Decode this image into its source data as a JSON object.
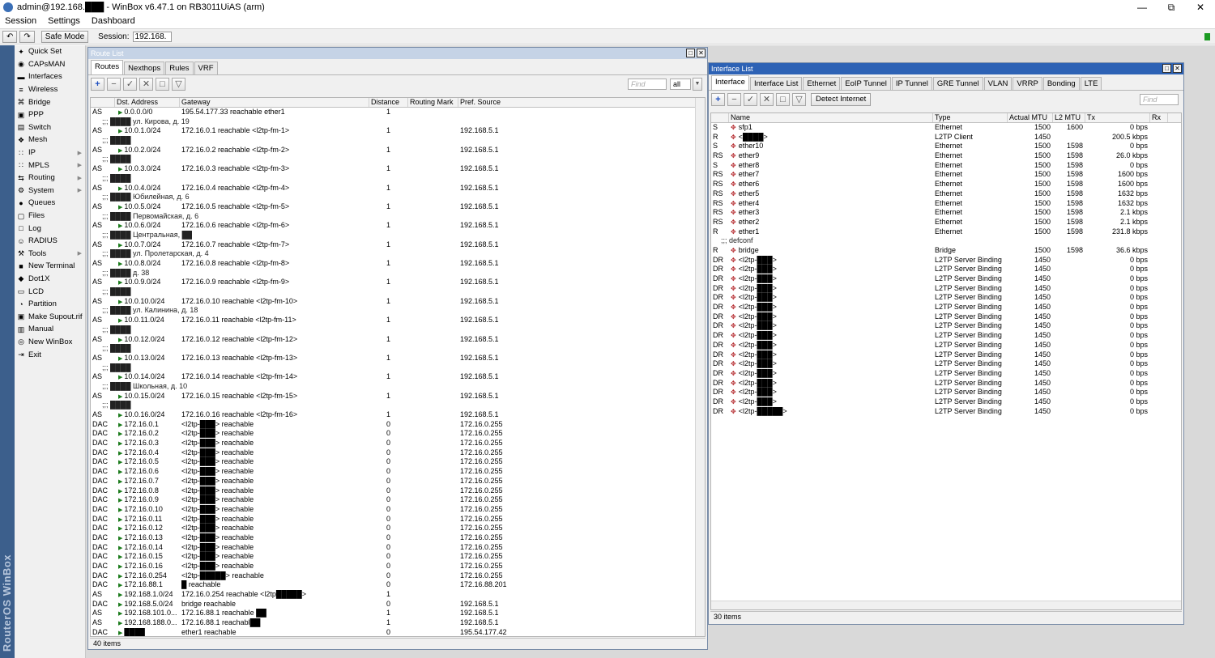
{
  "window": {
    "title": "admin@192.168.███ - WinBox v6.47.1 on RB3011UiAS (arm)",
    "controls": [
      "—",
      "⧉",
      "✕"
    ]
  },
  "menu": [
    "Session",
    "Settings",
    "Dashboard"
  ],
  "toolbar": {
    "undo": "↶",
    "redo": "↷",
    "safe_mode": "Safe Mode",
    "session_label": "Session:",
    "session_value": "192.168."
  },
  "brand_text": "RouterOS WinBox",
  "sidebar": [
    {
      "label": "Quick Set",
      "icon": "wand-icon",
      "glyph": "✦",
      "sub": false
    },
    {
      "label": "CAPsMAN",
      "icon": "capsman-icon",
      "glyph": "◉",
      "sub": false
    },
    {
      "label": "Interfaces",
      "icon": "interfaces-icon",
      "glyph": "▬",
      "sub": false
    },
    {
      "label": "Wireless",
      "icon": "wireless-icon",
      "glyph": "≡",
      "sub": false
    },
    {
      "label": "Bridge",
      "icon": "bridge-icon",
      "glyph": "⌘",
      "sub": false
    },
    {
      "label": "PPP",
      "icon": "ppp-icon",
      "glyph": "▣",
      "sub": false
    },
    {
      "label": "Switch",
      "icon": "switch-icon",
      "glyph": "▤",
      "sub": false
    },
    {
      "label": "Mesh",
      "icon": "mesh-icon",
      "glyph": "❖",
      "sub": false
    },
    {
      "label": "IP",
      "icon": "ip-icon",
      "glyph": "∷",
      "sub": true
    },
    {
      "label": "MPLS",
      "icon": "mpls-icon",
      "glyph": "∷",
      "sub": true
    },
    {
      "label": "Routing",
      "icon": "routing-icon",
      "glyph": "⇆",
      "sub": true
    },
    {
      "label": "System",
      "icon": "system-icon",
      "glyph": "⚙",
      "sub": true
    },
    {
      "label": "Queues",
      "icon": "queues-icon",
      "glyph": "●",
      "sub": false
    },
    {
      "label": "Files",
      "icon": "files-icon",
      "glyph": "▢",
      "sub": false
    },
    {
      "label": "Log",
      "icon": "log-icon",
      "glyph": "□",
      "sub": false
    },
    {
      "label": "RADIUS",
      "icon": "radius-icon",
      "glyph": "☺",
      "sub": false
    },
    {
      "label": "Tools",
      "icon": "tools-icon",
      "glyph": "⚒",
      "sub": true
    },
    {
      "label": "New Terminal",
      "icon": "terminal-icon",
      "glyph": "■",
      "sub": false
    },
    {
      "label": "Dot1X",
      "icon": "dot1x-icon",
      "glyph": "◆",
      "sub": false
    },
    {
      "label": "LCD",
      "icon": "lcd-icon",
      "glyph": "▭",
      "sub": false
    },
    {
      "label": "Partition",
      "icon": "partition-icon",
      "glyph": "◔",
      "sub": false
    },
    {
      "label": "Make Supout.rif",
      "icon": "supout-icon",
      "glyph": "▣",
      "sub": false
    },
    {
      "label": "Manual",
      "icon": "manual-icon",
      "glyph": "▥",
      "sub": false
    },
    {
      "label": "New WinBox",
      "icon": "winbox-icon",
      "glyph": "◎",
      "sub": false
    },
    {
      "label": "Exit",
      "icon": "exit-icon",
      "glyph": "⇥",
      "sub": false
    }
  ],
  "route_list": {
    "title": "Route List",
    "tabs": [
      "Routes",
      "Nexthops",
      "Rules",
      "VRF"
    ],
    "tool_icons": [
      "+",
      "−",
      "✓",
      "✕",
      "□",
      "▽"
    ],
    "find_placeholder": "Find",
    "filter_value": "all",
    "columns": [
      "",
      "Dst. Address",
      "Gateway",
      "Distance",
      "Routing Mark",
      "Pref. Source"
    ],
    "rows": [
      {
        "flags": "AS",
        "dst": "0.0.0.0/0",
        "gw": "195.54.177.33 reachable ether1",
        "dist": "1",
        "mark": "",
        "pref": ""
      },
      {
        "comment": ";;; ████ ул. Кирова, д. 19"
      },
      {
        "flags": "AS",
        "dst": "10.0.1.0/24",
        "gw": "172.16.0.1 reachable <l2tp-fm-1>",
        "dist": "1",
        "mark": "",
        "pref": "192.168.5.1"
      },
      {
        "comment": ";;; ████"
      },
      {
        "flags": "AS",
        "dst": "10.0.2.0/24",
        "gw": "172.16.0.2 reachable <l2tp-fm-2>",
        "dist": "1",
        "mark": "",
        "pref": "192.168.5.1"
      },
      {
        "comment": ";;; ████"
      },
      {
        "flags": "AS",
        "dst": "10.0.3.0/24",
        "gw": "172.16.0.3 reachable <l2tp-fm-3>",
        "dist": "1",
        "mark": "",
        "pref": "192.168.5.1"
      },
      {
        "comment": ";;; ████"
      },
      {
        "flags": "AS",
        "dst": "10.0.4.0/24",
        "gw": "172.16.0.4 reachable <l2tp-fm-4>",
        "dist": "1",
        "mark": "",
        "pref": "192.168.5.1"
      },
      {
        "comment": ";;; ████ Юбилейная, д. 6"
      },
      {
        "flags": "AS",
        "dst": "10.0.5.0/24",
        "gw": "172.16.0.5 reachable <l2tp-fm-5>",
        "dist": "1",
        "mark": "",
        "pref": "192.168.5.1"
      },
      {
        "comment": ";;; ████ Первомайская, д. 6"
      },
      {
        "flags": "AS",
        "dst": "10.0.6.0/24",
        "gw": "172.16.0.6 reachable <l2tp-fm-6>",
        "dist": "1",
        "mark": "",
        "pref": "192.168.5.1"
      },
      {
        "comment": ";;; ████ Центральная, ██"
      },
      {
        "flags": "AS",
        "dst": "10.0.7.0/24",
        "gw": "172.16.0.7 reachable <l2tp-fm-7>",
        "dist": "1",
        "mark": "",
        "pref": "192.168.5.1"
      },
      {
        "comment": ";;; ████ ул. Пролетарская, д. 4"
      },
      {
        "flags": "AS",
        "dst": "10.0.8.0/24",
        "gw": "172.16.0.8 reachable <l2tp-fm-8>",
        "dist": "1",
        "mark": "",
        "pref": "192.168.5.1"
      },
      {
        "comment": ";;; ████ д. 38"
      },
      {
        "flags": "AS",
        "dst": "10.0.9.0/24",
        "gw": "172.16.0.9 reachable <l2tp-fm-9>",
        "dist": "1",
        "mark": "",
        "pref": "192.168.5.1"
      },
      {
        "comment": ";;; ████"
      },
      {
        "flags": "AS",
        "dst": "10.0.10.0/24",
        "gw": "172.16.0.10 reachable <l2tp-fm-10>",
        "dist": "1",
        "mark": "",
        "pref": "192.168.5.1"
      },
      {
        "comment": ";;; ████ ул. Калинина, д. 18"
      },
      {
        "flags": "AS",
        "dst": "10.0.11.0/24",
        "gw": "172.16.0.11 reachable <l2tp-fm-11>",
        "dist": "1",
        "mark": "",
        "pref": "192.168.5.1"
      },
      {
        "comment": ";;; ████"
      },
      {
        "flags": "AS",
        "dst": "10.0.12.0/24",
        "gw": "172.16.0.12 reachable <l2tp-fm-12>",
        "dist": "1",
        "mark": "",
        "pref": "192.168.5.1"
      },
      {
        "comment": ";;; ████"
      },
      {
        "flags": "AS",
        "dst": "10.0.13.0/24",
        "gw": "172.16.0.13 reachable <l2tp-fm-13>",
        "dist": "1",
        "mark": "",
        "pref": "192.168.5.1"
      },
      {
        "comment": ";;; ████"
      },
      {
        "flags": "AS",
        "dst": "10.0.14.0/24",
        "gw": "172.16.0.14 reachable <l2tp-fm-14>",
        "dist": "1",
        "mark": "",
        "pref": "192.168.5.1"
      },
      {
        "comment": ";;; ████ Школьная, д. 10"
      },
      {
        "flags": "AS",
        "dst": "10.0.15.0/24",
        "gw": "172.16.0.15 reachable <l2tp-fm-15>",
        "dist": "1",
        "mark": "",
        "pref": "192.168.5.1"
      },
      {
        "comment": ";;; ████"
      },
      {
        "flags": "AS",
        "dst": "10.0.16.0/24",
        "gw": "172.16.0.16 reachable <l2tp-fm-16>",
        "dist": "1",
        "mark": "",
        "pref": "192.168.5.1"
      },
      {
        "flags": "DAC",
        "dst": "172.16.0.1",
        "gw": "<l2tp-███> reachable",
        "dist": "0",
        "mark": "",
        "pref": "172.16.0.255"
      },
      {
        "flags": "DAC",
        "dst": "172.16.0.2",
        "gw": "<l2tp-███> reachable",
        "dist": "0",
        "mark": "",
        "pref": "172.16.0.255"
      },
      {
        "flags": "DAC",
        "dst": "172.16.0.3",
        "gw": "<l2tp-███> reachable",
        "dist": "0",
        "mark": "",
        "pref": "172.16.0.255"
      },
      {
        "flags": "DAC",
        "dst": "172.16.0.4",
        "gw": "<l2tp-███> reachable",
        "dist": "0",
        "mark": "",
        "pref": "172.16.0.255"
      },
      {
        "flags": "DAC",
        "dst": "172.16.0.5",
        "gw": "<l2tp-███> reachable",
        "dist": "0",
        "mark": "",
        "pref": "172.16.0.255"
      },
      {
        "flags": "DAC",
        "dst": "172.16.0.6",
        "gw": "<l2tp-███> reachable",
        "dist": "0",
        "mark": "",
        "pref": "172.16.0.255"
      },
      {
        "flags": "DAC",
        "dst": "172.16.0.7",
        "gw": "<l2tp-███> reachable",
        "dist": "0",
        "mark": "",
        "pref": "172.16.0.255"
      },
      {
        "flags": "DAC",
        "dst": "172.16.0.8",
        "gw": "<l2tp-███> reachable",
        "dist": "0",
        "mark": "",
        "pref": "172.16.0.255"
      },
      {
        "flags": "DAC",
        "dst": "172.16.0.9",
        "gw": "<l2tp-███> reachable",
        "dist": "0",
        "mark": "",
        "pref": "172.16.0.255"
      },
      {
        "flags": "DAC",
        "dst": "172.16.0.10",
        "gw": "<l2tp-███> reachable",
        "dist": "0",
        "mark": "",
        "pref": "172.16.0.255"
      },
      {
        "flags": "DAC",
        "dst": "172.16.0.11",
        "gw": "<l2tp-███> reachable",
        "dist": "0",
        "mark": "",
        "pref": "172.16.0.255"
      },
      {
        "flags": "DAC",
        "dst": "172.16.0.12",
        "gw": "<l2tp-███> reachable",
        "dist": "0",
        "mark": "",
        "pref": "172.16.0.255"
      },
      {
        "flags": "DAC",
        "dst": "172.16.0.13",
        "gw": "<l2tp-███> reachable",
        "dist": "0",
        "mark": "",
        "pref": "172.16.0.255"
      },
      {
        "flags": "DAC",
        "dst": "172.16.0.14",
        "gw": "<l2tp-███> reachable",
        "dist": "0",
        "mark": "",
        "pref": "172.16.0.255"
      },
      {
        "flags": "DAC",
        "dst": "172.16.0.15",
        "gw": "<l2tp-███> reachable",
        "dist": "0",
        "mark": "",
        "pref": "172.16.0.255"
      },
      {
        "flags": "DAC",
        "dst": "172.16.0.16",
        "gw": "<l2tp-███> reachable",
        "dist": "0",
        "mark": "",
        "pref": "172.16.0.255"
      },
      {
        "flags": "DAC",
        "dst": "172.16.0.254",
        "gw": "<l2tp-█████> reachable",
        "dist": "0",
        "mark": "",
        "pref": "172.16.0.255"
      },
      {
        "flags": "DAC",
        "dst": "172.16.88.1",
        "gw": "█ reachable",
        "dist": "0",
        "mark": "",
        "pref": "172.16.88.201"
      },
      {
        "flags": "AS",
        "dst": "192.168.1.0/24",
        "gw": "172.16.0.254 reachable <l2tp█████>",
        "dist": "1",
        "mark": "",
        "pref": ""
      },
      {
        "flags": "DAC",
        "dst": "192.168.5.0/24",
        "gw": "bridge reachable",
        "dist": "0",
        "mark": "",
        "pref": "192.168.5.1"
      },
      {
        "flags": "AS",
        "dst": "192.168.101.0...",
        "gw": "172.16.88.1 reachable ██",
        "dist": "1",
        "mark": "",
        "pref": "192.168.5.1"
      },
      {
        "flags": "AS",
        "dst": "192.168.188.0...",
        "gw": "172.16.88.1 reachabl██",
        "dist": "1",
        "mark": "",
        "pref": "192.168.5.1"
      },
      {
        "flags": "DAC",
        "dst": "████",
        "gw": "ether1 reachable",
        "dist": "0",
        "mark": "",
        "pref": "195.54.177.42"
      }
    ],
    "status": "40 items"
  },
  "interface_list": {
    "title": "Interface List",
    "tabs": [
      "Interface",
      "Interface List",
      "Ethernet",
      "EoIP Tunnel",
      "IP Tunnel",
      "GRE Tunnel",
      "VLAN",
      "VRRP",
      "Bonding",
      "LTE"
    ],
    "tool_icons": [
      "+",
      "−",
      "✓",
      "✕",
      "□",
      "▽"
    ],
    "detect_button": "Detect Internet",
    "find_placeholder": "Find",
    "columns": [
      "",
      "Name",
      "Type",
      "Actual MTU",
      "L2 MTU",
      "Tx",
      "Rx"
    ],
    "rows": [
      {
        "flags": "S",
        "name": "sfp1",
        "type": "Ethernet",
        "mtu": "1500",
        "l2": "1600",
        "tx": "0 bps"
      },
      {
        "flags": "R",
        "name": "<████>",
        "type": "L2TP Client",
        "mtu": "1450",
        "l2": "",
        "tx": "200.5 kbps"
      },
      {
        "flags": "S",
        "name": "ether10",
        "type": "Ethernet",
        "mtu": "1500",
        "l2": "1598",
        "tx": "0 bps"
      },
      {
        "flags": "RS",
        "name": "ether9",
        "type": "Ethernet",
        "mtu": "1500",
        "l2": "1598",
        "tx": "26.0 kbps"
      },
      {
        "flags": "S",
        "name": "ether8",
        "type": "Ethernet",
        "mtu": "1500",
        "l2": "1598",
        "tx": "0 bps"
      },
      {
        "flags": "RS",
        "name": "ether7",
        "type": "Ethernet",
        "mtu": "1500",
        "l2": "1598",
        "tx": "1600 bps"
      },
      {
        "flags": "RS",
        "name": "ether6",
        "type": "Ethernet",
        "mtu": "1500",
        "l2": "1598",
        "tx": "1600 bps"
      },
      {
        "flags": "RS",
        "name": "ether5",
        "type": "Ethernet",
        "mtu": "1500",
        "l2": "1598",
        "tx": "1632 bps"
      },
      {
        "flags": "RS",
        "name": "ether4",
        "type": "Ethernet",
        "mtu": "1500",
        "l2": "1598",
        "tx": "1632 bps"
      },
      {
        "flags": "RS",
        "name": "ether3",
        "type": "Ethernet",
        "mtu": "1500",
        "l2": "1598",
        "tx": "2.1 kbps"
      },
      {
        "flags": "RS",
        "name": "ether2",
        "type": "Ethernet",
        "mtu": "1500",
        "l2": "1598",
        "tx": "2.1 kbps"
      },
      {
        "flags": "R",
        "name": "ether1",
        "type": "Ethernet",
        "mtu": "1500",
        "l2": "1598",
        "tx": "231.8 kbps"
      },
      {
        "comment": ";;; defconf"
      },
      {
        "flags": "R",
        "name": "bridge",
        "type": "Bridge",
        "mtu": "1500",
        "l2": "1598",
        "tx": "36.6 kbps"
      },
      {
        "flags": "DR",
        "name": "<l2tp-███>",
        "type": "L2TP Server Binding",
        "mtu": "1450",
        "l2": "",
        "tx": "0 bps"
      },
      {
        "flags": "DR",
        "name": "<l2tp-███>",
        "type": "L2TP Server Binding",
        "mtu": "1450",
        "l2": "",
        "tx": "0 bps"
      },
      {
        "flags": "DR",
        "name": "<l2tp-███>",
        "type": "L2TP Server Binding",
        "mtu": "1450",
        "l2": "",
        "tx": "0 bps"
      },
      {
        "flags": "DR",
        "name": "<l2tp-███>",
        "type": "L2TP Server Binding",
        "mtu": "1450",
        "l2": "",
        "tx": "0 bps"
      },
      {
        "flags": "DR",
        "name": "<l2tp-███>",
        "type": "L2TP Server Binding",
        "mtu": "1450",
        "l2": "",
        "tx": "0 bps"
      },
      {
        "flags": "DR",
        "name": "<l2tp-███>",
        "type": "L2TP Server Binding",
        "mtu": "1450",
        "l2": "",
        "tx": "0 bps"
      },
      {
        "flags": "DR",
        "name": "<l2tp-███>",
        "type": "L2TP Server Binding",
        "mtu": "1450",
        "l2": "",
        "tx": "0 bps"
      },
      {
        "flags": "DR",
        "name": "<l2tp-███>",
        "type": "L2TP Server Binding",
        "mtu": "1450",
        "l2": "",
        "tx": "0 bps"
      },
      {
        "flags": "DR",
        "name": "<l2tp-███>",
        "type": "L2TP Server Binding",
        "mtu": "1450",
        "l2": "",
        "tx": "0 bps"
      },
      {
        "flags": "DR",
        "name": "<l2tp-███>",
        "type": "L2TP Server Binding",
        "mtu": "1450",
        "l2": "",
        "tx": "0 bps"
      },
      {
        "flags": "DR",
        "name": "<l2tp-███>",
        "type": "L2TP Server Binding",
        "mtu": "1450",
        "l2": "",
        "tx": "0 bps"
      },
      {
        "flags": "DR",
        "name": "<l2tp-███>",
        "type": "L2TP Server Binding",
        "mtu": "1450",
        "l2": "",
        "tx": "0 bps"
      },
      {
        "flags": "DR",
        "name": "<l2tp-███>",
        "type": "L2TP Server Binding",
        "mtu": "1450",
        "l2": "",
        "tx": "0 bps"
      },
      {
        "flags": "DR",
        "name": "<l2tp-███>",
        "type": "L2TP Server Binding",
        "mtu": "1450",
        "l2": "",
        "tx": "0 bps"
      },
      {
        "flags": "DR",
        "name": "<l2tp-███>",
        "type": "L2TP Server Binding",
        "mtu": "1450",
        "l2": "",
        "tx": "0 bps"
      },
      {
        "flags": "DR",
        "name": "<l2tp-███>",
        "type": "L2TP Server Binding",
        "mtu": "1450",
        "l2": "",
        "tx": "0 bps"
      },
      {
        "flags": "DR",
        "name": "<l2tp-█████>",
        "type": "L2TP Server Binding",
        "mtu": "1450",
        "l2": "",
        "tx": "0 bps"
      }
    ],
    "status": "30 items"
  }
}
